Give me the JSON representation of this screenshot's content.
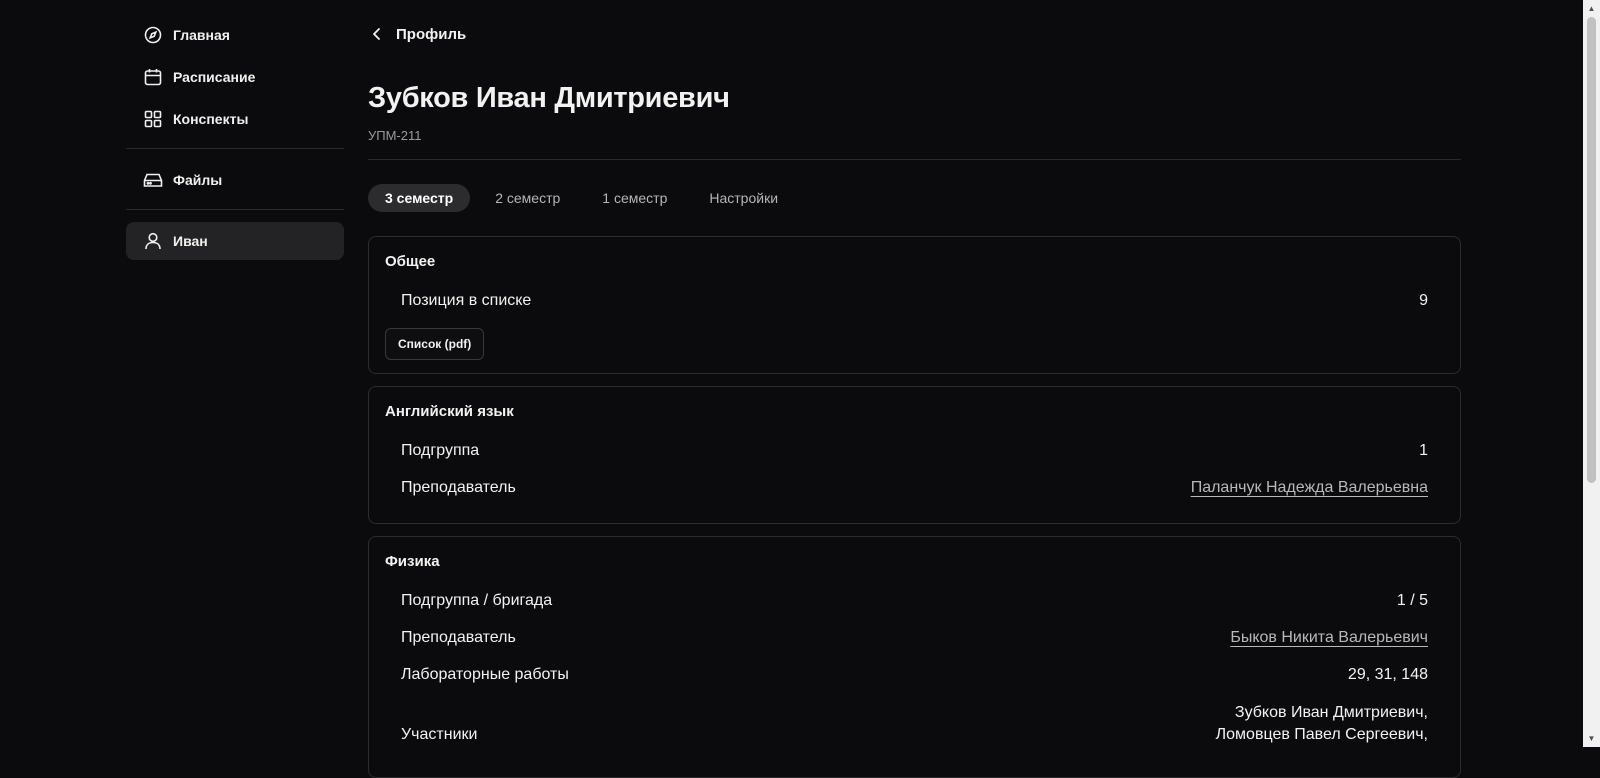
{
  "sidebar": {
    "items": [
      {
        "label": "Главная",
        "icon": "compass-icon"
      },
      {
        "label": "Расписание",
        "icon": "calendar-icon"
      },
      {
        "label": "Конспекты",
        "icon": "grid-icon"
      },
      {
        "label": "Файлы",
        "icon": "drive-icon"
      },
      {
        "label": "Иван",
        "icon": "user-icon",
        "active": true
      }
    ]
  },
  "header": {
    "back_label": "Профиль",
    "name": "Зубков Иван Дмитриевич",
    "group": "УПМ-211"
  },
  "tabs": [
    {
      "label": "3 семестр",
      "active": true
    },
    {
      "label": "2 семестр"
    },
    {
      "label": "1 семестр"
    },
    {
      "label": "Настройки"
    }
  ],
  "cards": {
    "general": {
      "title": "Общее",
      "position_label": "Позиция в списке",
      "position_value": "9",
      "list_button": "Список (pdf)"
    },
    "english": {
      "title": "Английский язык",
      "subgroup_label": "Подгруппа",
      "subgroup_value": "1",
      "teacher_label": "Преподаватель",
      "teacher_value": "Паланчук Надежда Валерьевна"
    },
    "physics": {
      "title": "Физика",
      "subgroup_label": "Подгруппа / бригада",
      "subgroup_value": "1 / 5",
      "teacher_label": "Преподаватель",
      "teacher_value": "Быков Никита Валерьевич",
      "labs_label": "Лабораторные работы",
      "labs_value": "29, 31, 148",
      "members_label": "Участники",
      "members": [
        "Зубков Иван Дмитриевич,",
        "Ломовцев Павел Сергеевич,"
      ]
    }
  },
  "colors": {
    "background": "#0b0b0d",
    "card_border": "#2c2c2e",
    "active_bg": "#232325"
  }
}
